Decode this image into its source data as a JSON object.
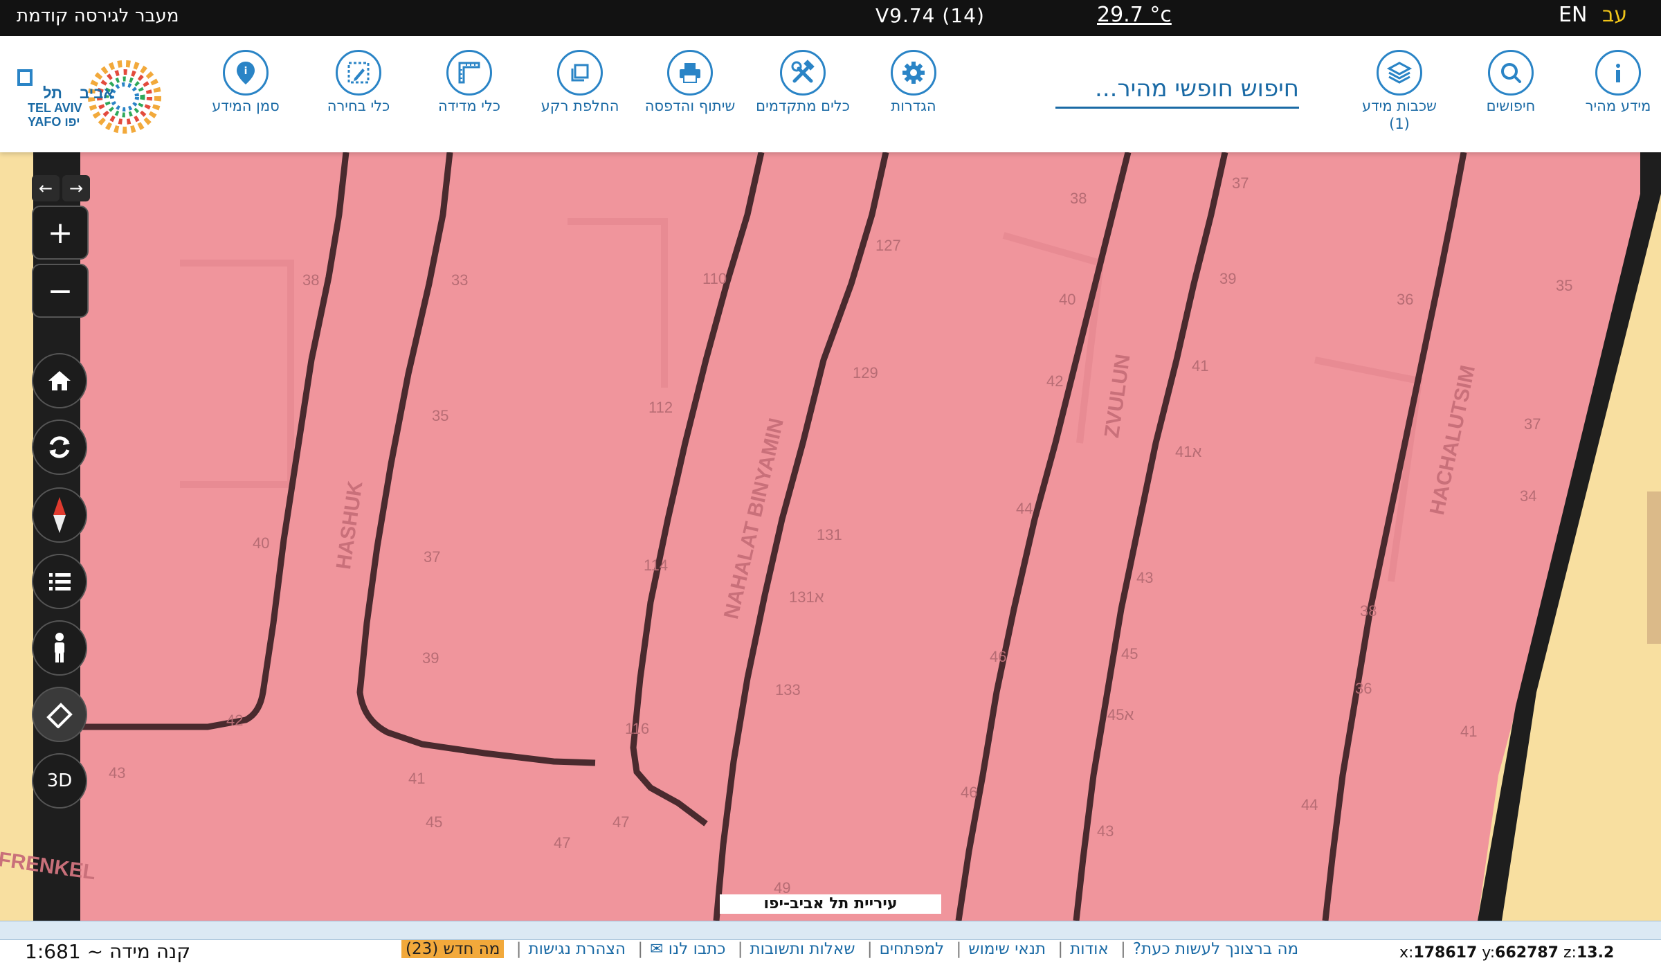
{
  "topbar": {
    "prev_version": "מעבר לגירסה קודמת",
    "version": "V9.74 (14)",
    "temperature": "29.7 °c",
    "lang_en": "EN",
    "lang_he": "עב"
  },
  "header": {
    "search_placeholder": "חיפוש חופשי מהיר...",
    "tools": {
      "quick_info": "מידע מהיר",
      "searches": "חיפושים",
      "layers": "שכבות מידע",
      "layers_count": "(1)",
      "settings": "הגדרות",
      "advanced_tools": "כלים מתקדמים",
      "share_print": "שיתוף והדפסה",
      "basemap": "החלפת רקע",
      "measure": "כלי מדידה",
      "select": "כלי בחירה",
      "mark_info": "סמן המידע"
    },
    "logo": {
      "tel": "תל",
      "aviv_he": "אביב",
      "aviv_en": "TEL AVIV",
      "yafo": "YAFO יפו"
    }
  },
  "map": {
    "city_label": "עיריית תל אביב-יפו",
    "streets": [
      "HASHUK",
      "NAHALAT BINYAMIN",
      "ZVULUN",
      "HACHALUTSIM",
      "FRENKEL"
    ],
    "house_numbers": [
      "38",
      "33",
      "110",
      "127",
      "38",
      "37",
      "39",
      "36",
      "35",
      "40",
      "129",
      "41",
      "35",
      "112",
      "42",
      "41א",
      "37",
      "40",
      "34",
      "37",
      "131",
      "44",
      "43",
      "38",
      "131א",
      "39",
      "114",
      "46",
      "45",
      "36",
      "42",
      "133",
      "45א",
      "41",
      "43",
      "116",
      "46",
      "44",
      "41",
      "45",
      "47",
      "47",
      "43",
      "49"
    ],
    "controls": {
      "zoom_in": "+",
      "zoom_out": "−",
      "view_3d": "3D"
    }
  },
  "footer": {
    "scale_label": "קנה מידה ~ 1:681",
    "links": [
      "מה ברצונך לעשות כעת?",
      "אודות",
      "תנאי שימוש",
      "למפתחים",
      "שאלות ותשובות",
      "כתבו לנו ✉",
      "הצהרת נגישות"
    ],
    "news": "מה חדש (23)",
    "coord_x_label": "x:",
    "coord_x": "178617",
    "coord_y_label": "y:",
    "coord_y": "662787",
    "coord_z_label": "z:",
    "coord_z": "13.2"
  },
  "colors": {
    "accent": "#1a6aa5",
    "parcel_fill": "#f0959c",
    "background_map": "#f8dfa0",
    "topbar": "#121212"
  }
}
